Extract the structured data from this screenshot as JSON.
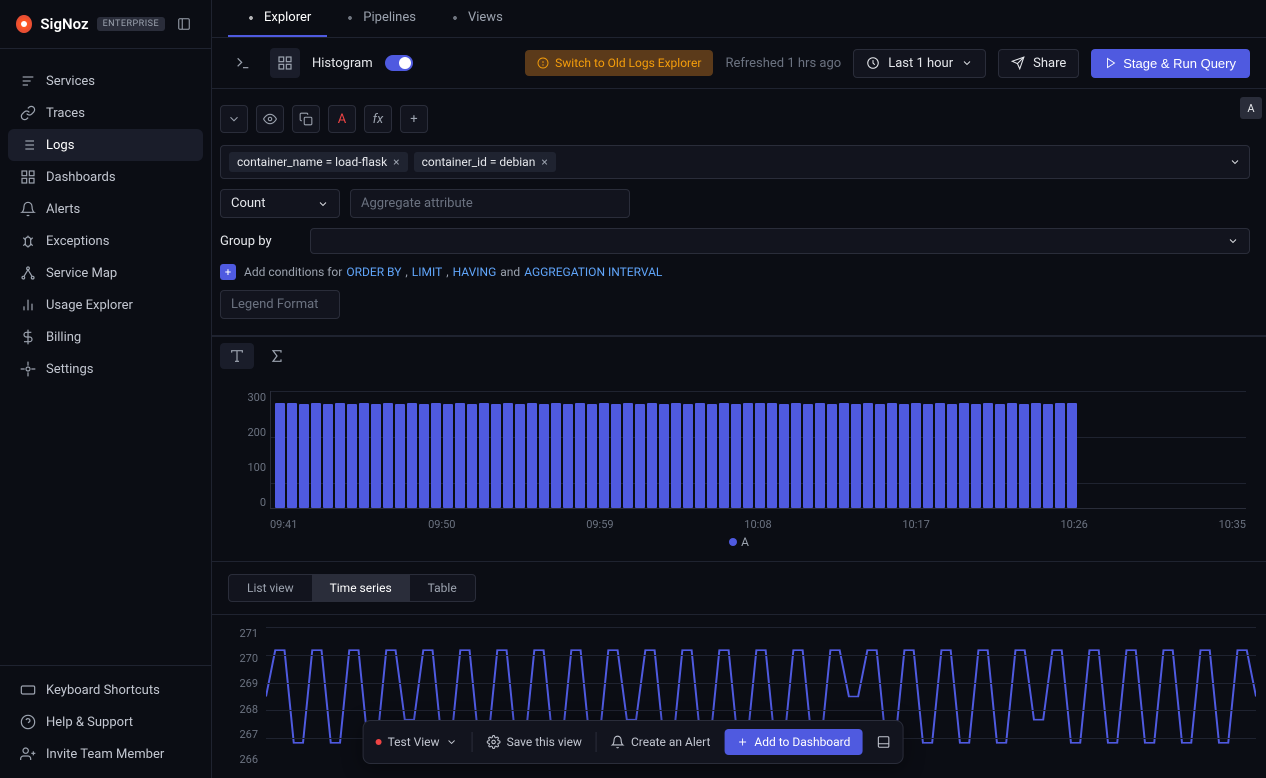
{
  "brand": {
    "name": "SigNoz",
    "tier": "ENTERPRISE"
  },
  "sidebar": {
    "items": [
      {
        "label": "Services",
        "icon": "bars"
      },
      {
        "label": "Traces",
        "icon": "link"
      },
      {
        "label": "Logs",
        "icon": "logs",
        "active": true
      },
      {
        "label": "Dashboards",
        "icon": "grid"
      },
      {
        "label": "Alerts",
        "icon": "bell"
      },
      {
        "label": "Exceptions",
        "icon": "bug"
      },
      {
        "label": "Service Map",
        "icon": "map"
      },
      {
        "label": "Usage Explorer",
        "icon": "chart"
      },
      {
        "label": "Billing",
        "icon": "dollar"
      },
      {
        "label": "Settings",
        "icon": "gear"
      }
    ],
    "footer": [
      {
        "label": "Keyboard Shortcuts",
        "icon": "keyboard"
      },
      {
        "label": "Help & Support",
        "icon": "help"
      },
      {
        "label": "Invite Team Member",
        "icon": "user-plus"
      }
    ]
  },
  "tabs": [
    {
      "label": "Explorer",
      "active": true
    },
    {
      "label": "Pipelines"
    },
    {
      "label": "Views"
    }
  ],
  "toolbar": {
    "mode": "Histogram",
    "switch_old": "Switch to Old Logs Explorer",
    "refreshed": "Refreshed 1 hrs ago",
    "timerange": "Last 1 hour",
    "share": "Share",
    "run": "Stage & Run Query"
  },
  "query": {
    "filters": [
      {
        "text": "container_name = load-flask"
      },
      {
        "text": "container_id = debian"
      }
    ],
    "agg": "Count",
    "agg_placeholder": "Aggregate attribute",
    "group_by": "Group by",
    "cond_prefix": "Add conditions for",
    "cond_links": {
      "order": "ORDER BY",
      "limit": "LIMIT",
      "having": "HAVING",
      "aggint": "AGGREGATION INTERVAL",
      "and": "and"
    },
    "legend_placeholder": "Legend Format",
    "badge": "A"
  },
  "chart_data": {
    "type": "bar",
    "title": "",
    "ylim": [
      0,
      300
    ],
    "y_ticks": [
      300,
      200,
      100,
      0
    ],
    "x_ticks": [
      "09:41",
      "09:50",
      "09:59",
      "10:08",
      "10:17",
      "10:26",
      "10:35"
    ],
    "legend": "A",
    "values": [
      268,
      270,
      266,
      270,
      266,
      270,
      266,
      270,
      266,
      270,
      266,
      270,
      267,
      270,
      266,
      270,
      266,
      270,
      266,
      270,
      266,
      270,
      266,
      270,
      266,
      270,
      267,
      270,
      266,
      270,
      266,
      270,
      266,
      270,
      266,
      270,
      266,
      270,
      266,
      270,
      268,
      270,
      266,
      270,
      266,
      270,
      266,
      270,
      266,
      270,
      266,
      270,
      267,
      270,
      266,
      270,
      266,
      270,
      266,
      270,
      266,
      270,
      266,
      270,
      266,
      270,
      268
    ]
  },
  "view_tabs": [
    "List view",
    "Time series",
    "Table"
  ],
  "view_active": "Time series",
  "ts_data": {
    "type": "line",
    "y_ticks": [
      271,
      270,
      269,
      268,
      267,
      266
    ],
    "ylim": [
      265,
      271
    ],
    "values": [
      268,
      270,
      270,
      266,
      266,
      270,
      270,
      266,
      266,
      270,
      270,
      266,
      266,
      270,
      270,
      267,
      267,
      270,
      270,
      266,
      266,
      270,
      270,
      266,
      266,
      270,
      270,
      266,
      266,
      270,
      270,
      266,
      266,
      270,
      270,
      266,
      266,
      270,
      270,
      267,
      267,
      270,
      270,
      266,
      266,
      270,
      270,
      266,
      266,
      270,
      270,
      266,
      266,
      270,
      270,
      266,
      266,
      270,
      270,
      266,
      266,
      270,
      270,
      268,
      268,
      270,
      270,
      266,
      266,
      270,
      270,
      266,
      266,
      270,
      270,
      266,
      266,
      270,
      270,
      266,
      266,
      270,
      270,
      267,
      267,
      270,
      270,
      266,
      266,
      270,
      270,
      266,
      266,
      270,
      270,
      266,
      266,
      270,
      270,
      266,
      266,
      270,
      270,
      266,
      266,
      270,
      270,
      268
    ]
  },
  "floating": {
    "view_name": "Test View",
    "save": "Save this view",
    "alert": "Create an Alert",
    "dashboard": "Add to Dashboard"
  }
}
